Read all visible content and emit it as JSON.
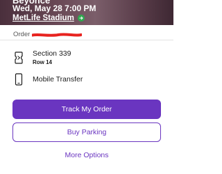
{
  "event": {
    "title": "Beyoncé",
    "datetime": "Wed, May 28 7:00 PM",
    "venue": "MetLife Stadium",
    "venue_badge_color": "#2fa84f"
  },
  "order": {
    "label": "Order",
    "number_redaction_color": "#e8231f"
  },
  "ticket": {
    "section": "Section 339",
    "row": "Row 14",
    "icon": "ticket-icon"
  },
  "delivery": {
    "method": "Mobile Transfer",
    "icon": "mobile-phone-icon"
  },
  "actions": {
    "track_order": "Track My Order",
    "buy_parking": "Buy Parking",
    "more_options": "More Options"
  },
  "theme": {
    "accent": "#6a35c0"
  }
}
